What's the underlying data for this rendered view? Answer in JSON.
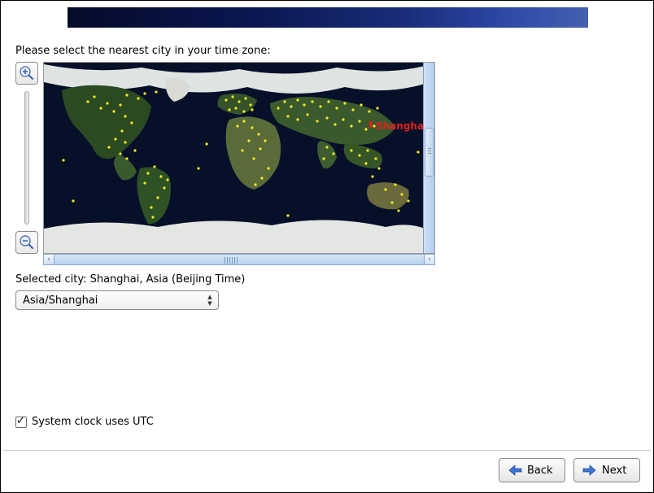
{
  "prompt": "Please select the nearest city in your time zone:",
  "map": {
    "selected_city_label": "Shanghai",
    "marker_color": "#e02020",
    "city_dot_color": "#f4ec1f"
  },
  "selected_line": "Selected city: Shanghai, Asia (Beijing Time)",
  "timezone": {
    "value": "Asia/Shanghai"
  },
  "utc_checkbox": {
    "label": "System clock uses UTC",
    "checked": true
  },
  "buttons": {
    "back": "Back",
    "next": "Next"
  }
}
